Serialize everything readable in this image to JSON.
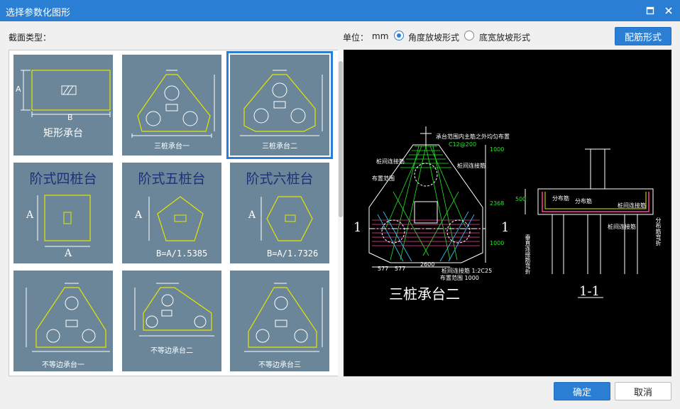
{
  "window": {
    "title": "选择参数化图形",
    "maximize_icon": "maximize-icon",
    "close_icon": "close-icon"
  },
  "toolbar": {
    "section_label": "截面类型：",
    "unit_label": "单位：",
    "unit_value": "mm",
    "options": [
      {
        "label": "角度放坡形式",
        "checked": true
      },
      {
        "label": "底宽放坡形式",
        "checked": false
      }
    ],
    "rebar_button": "配筋形式"
  },
  "gallery": {
    "tiles": [
      {
        "caption": "矩形承台",
        "dim_a": "A",
        "dim_b": "B",
        "selected": false
      },
      {
        "caption": "三桩承台一",
        "selected": false
      },
      {
        "caption": "三桩承台二",
        "selected": true
      },
      {
        "title": "阶式四桩台",
        "dim_a": "A",
        "dim_b": "A",
        "selected": false
      },
      {
        "title": "阶式五桩台",
        "dim_a": "A",
        "formula": "B=A/1.5385",
        "selected": false
      },
      {
        "title": "阶式六桩台",
        "dim_a": "A",
        "formula": "B=A/1.7326",
        "selected": false
      },
      {
        "caption": "不等边承台一",
        "selected": false
      },
      {
        "caption": "不等边承台二",
        "selected": false
      },
      {
        "caption": "不等边承台三",
        "selected": false
      }
    ]
  },
  "preview": {
    "plan_title": "三桩承台二",
    "section_title": "1-1",
    "section_mark": "1",
    "notes": {
      "main_rebar": "承台范围内主筋之外均匀布置",
      "c12": "C12@200",
      "tie_beam": "桩间连接筋",
      "layout_range": "布置范围",
      "tie_c25": "桩间连接筋 1:2C25",
      "range_1000": "布置范围 1000",
      "dist_bar": "分布筋",
      "dim_1000": "1000",
      "dim_2368": "2368",
      "dim_2600": "2600",
      "dim_577a": "577",
      "dim_577b": "577",
      "dim_500": "500",
      "tie_bar_s": "桩间连接筋",
      "vert_a": "垂直连接筋弯折",
      "vert_b": "分布筋弯折"
    }
  },
  "footer": {
    "ok": "确定",
    "cancel": "取消"
  },
  "colors": {
    "accent": "#2a7fd4",
    "tile_bg": "#6a8698",
    "tile_line": "#e6e600",
    "preview_bg": "#000000"
  }
}
